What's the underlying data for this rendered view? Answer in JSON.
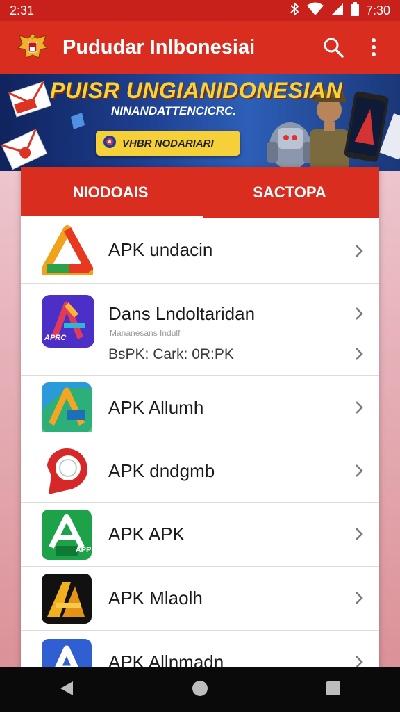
{
  "status_bar": {
    "time_left": "2:31",
    "time_right": "7:30",
    "icons": [
      "bluetooth-icon",
      "wifi-icon",
      "signal-icon",
      "battery-icon"
    ]
  },
  "app_bar": {
    "title": "Pududar Inlbonesiai",
    "logo_icon": "garuda-emblem-icon",
    "search_icon": "search-icon",
    "menu_icon": "more-vertical-icon"
  },
  "banner": {
    "headline": "PUISR UNGIANIDONESIAN",
    "subtitle": "NINANDATTENCICRC.",
    "cta_label": "VHBR NODARIARI"
  },
  "tabs": [
    {
      "label": "NIODOAIS",
      "active": true
    },
    {
      "label": "SACTOPA",
      "active": false
    }
  ],
  "list": [
    {
      "title": "APK undacin",
      "icon": "triangle-rainbow-icon"
    },
    {
      "title": "Dans Lndoltaridan",
      "caption": "Mananesans Indulf",
      "subtitle": "BsPK:  Cark: 0R:PK",
      "icon": "purple-a-app-icon",
      "icon_label": "APRC"
    },
    {
      "title": "APK Allumh",
      "icon": "blue-a-app-icon"
    },
    {
      "title": "APK dndgmb",
      "icon": "red-pin-icon"
    },
    {
      "title": "APK APK",
      "icon": "green-a-app-icon",
      "icon_label": "APP"
    },
    {
      "title": "APK Mlaolh",
      "icon": "black-yellow-a-icon"
    },
    {
      "title": "APK Allnmadn",
      "icon": "blue-white-a-icon"
    }
  ],
  "colors": {
    "primary": "#d92d20",
    "status_bar": "#c8201a",
    "banner_accent": "#f4d43a",
    "nav_bar": "#0a0a0a"
  },
  "nav_bar": {
    "icons": [
      "back-icon",
      "home-icon",
      "recents-icon"
    ]
  }
}
